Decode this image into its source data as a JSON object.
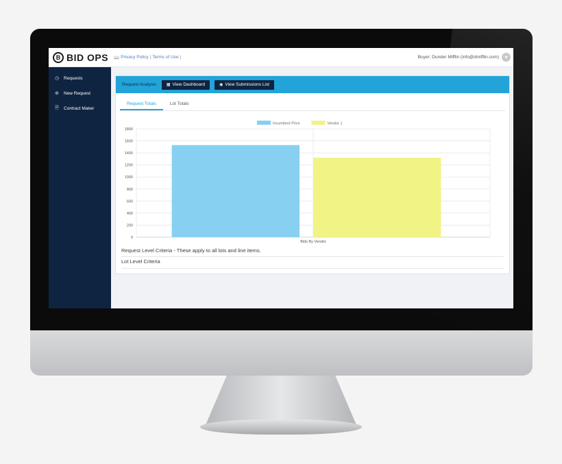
{
  "header": {
    "logo_letter": "B",
    "logo_text": "BID OPS",
    "privacy": "Privacy Policy",
    "terms": "Terms of Use",
    "buyer": "Buyer: Dunder Mifflin (info@dmifflin.com)"
  },
  "sidebar": {
    "items": [
      {
        "label": "Requests",
        "icon": "gauge-icon"
      },
      {
        "label": "New Request",
        "icon": "plus-circle-icon"
      },
      {
        "label": "Contract Maker",
        "icon": "document-icon"
      }
    ]
  },
  "analysis": {
    "title": "Request Analysis",
    "dashboard_label": "View Dashboard",
    "submissions_label": "View Submissions List"
  },
  "tabs": [
    {
      "label": "Request Totals",
      "active": true
    },
    {
      "label": "Lot Totals",
      "active": false
    }
  ],
  "chart_data": {
    "type": "bar",
    "categories": [
      "Bids By Vendor"
    ],
    "series": [
      {
        "name": "Incumbent Price",
        "color": "#87d0f2",
        "values": [
          1530
        ]
      },
      {
        "name": "Vendor 1",
        "color": "#f1f385",
        "values": [
          1320
        ]
      }
    ],
    "xlabel": "Bids By Vendor",
    "ylim": [
      0,
      1800
    ],
    "yticks": [
      0,
      200,
      400,
      600,
      800,
      1000,
      1200,
      1400,
      1600,
      1800
    ],
    "grid": true,
    "legend": "top-center"
  },
  "criteria": {
    "request_level": "Request Level Criteria - These apply to all lots and line items.",
    "lot_level": "Lot Level Criteria"
  },
  "colors": {
    "sidebar": "#0f2440",
    "accent": "#23a4d9",
    "button": "#0f2440"
  }
}
